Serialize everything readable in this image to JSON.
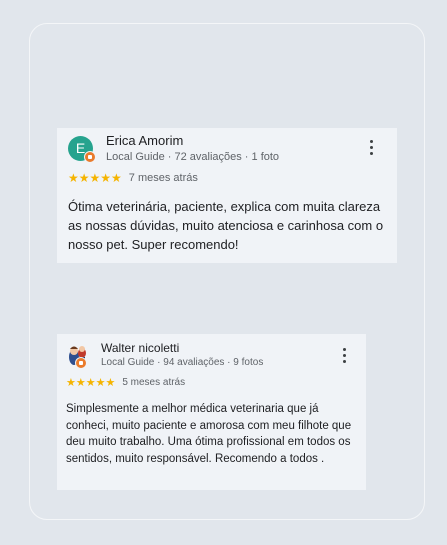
{
  "reviews": [
    {
      "avatar_letter": "E",
      "avatar_color": "#26a38e",
      "name": "Erica Amorim",
      "meta": "Local Guide · 72 avaliações · 1 foto",
      "rating": 5,
      "stars": "★★★★★",
      "date": "7 meses atrás",
      "text": "Ótima veterinária, paciente, explica com muita clareza as nossas dúvidas, muito atenciosa e carinhosa com o nosso pet. Super recomendo!"
    },
    {
      "avatar_icon": "cartoon-avatar-icon",
      "name": "Walter nicoletti",
      "meta": "Local Guide · 94 avaliações · 9 fotos",
      "rating": 5,
      "stars": "★★★★★",
      "date": "5 meses atrás",
      "text": "Simplesmente a melhor médica veterinaria que já conheci, muito paciente e amorosa com meu filhote que deu muito trabalho. Uma ótima profissional em todos os sentidos, muito responsável. Recomendo a todos ."
    }
  ],
  "colors": {
    "star": "#f5b400",
    "badge": "#ea7b2c"
  }
}
